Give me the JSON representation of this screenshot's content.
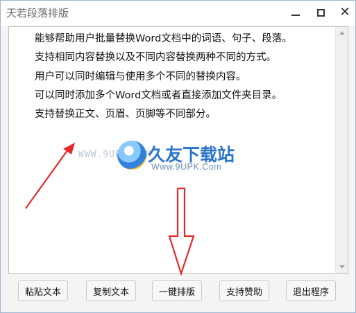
{
  "window": {
    "title": "天若段落排版",
    "controls": {
      "minimize": "minimize-icon",
      "maximize": "maximize-icon",
      "close": "close-icon"
    }
  },
  "editor": {
    "lines": [
      "能够帮助用户批量替换Word文档中的词语、句子、段落。",
      "支持相同内容替换以及不同内容替换两种不同的方式。",
      "用户可以同时编辑与使用多个不同的替换内容。",
      "可以同时添加多个Word文档或者直接添加文件夹目录。",
      "支持替换正文、页眉、页脚等不同部分。"
    ]
  },
  "watermark": {
    "site_small": "WWW.9UPK.COM",
    "brand": "久友下载站",
    "url": "Www.9UPK.Com"
  },
  "buttons": {
    "paste": "粘贴文本",
    "copy": "复制文本",
    "format": "一键排版",
    "support": "支持赞助",
    "exit": "退出程序"
  },
  "colors": {
    "annotation_arrow": "#e8262a",
    "brand": "#2a74c9"
  }
}
